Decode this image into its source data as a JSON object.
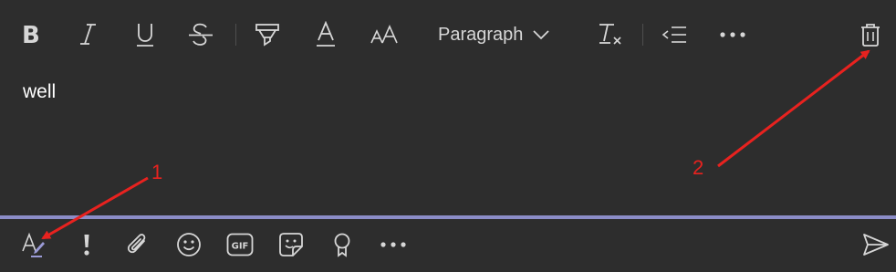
{
  "toolbar": {
    "paragraph_label": "Paragraph",
    "icons": [
      "bold-icon",
      "italic-icon",
      "underline-icon",
      "strikethrough-icon",
      "highlight-icon",
      "font-color-icon",
      "font-size-icon",
      "paragraph-chevron-icon",
      "clear-formatting-icon",
      "decrease-indent-icon",
      "more-options-icon",
      "delete-icon"
    ]
  },
  "message": {
    "text": "well"
  },
  "bottom_bar": {
    "icons": [
      "format-icon",
      "important-icon",
      "attach-icon",
      "emoji-icon",
      "gif-icon",
      "sticker-icon",
      "praise-icon",
      "more-options-icon",
      "send-icon"
    ]
  },
  "annotations": {
    "label_1": "1",
    "label_2": "2",
    "color": "#e8221f"
  },
  "colors": {
    "background": "#2d2d2d",
    "accent": "#8b8cc7",
    "icon": "#d6d6d6",
    "text": "#ffffff"
  }
}
